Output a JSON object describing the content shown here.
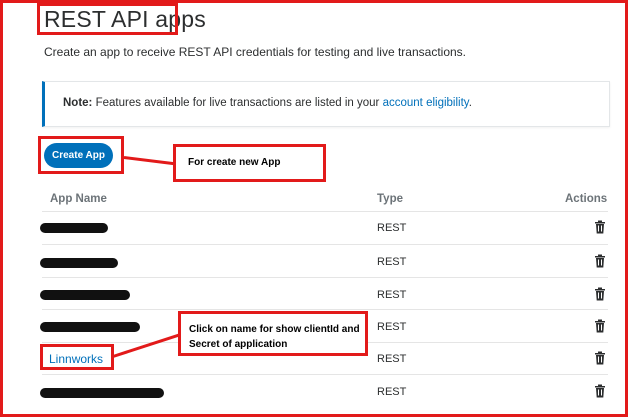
{
  "page": {
    "title": "REST API apps",
    "subtitle": "Create an app to receive REST API credentials for testing and live transactions."
  },
  "note": {
    "label": "Note:",
    "text": " Features available for live transactions are listed in your ",
    "link": "account eligibility",
    "period": "."
  },
  "create_button": "Create App",
  "annotations": {
    "create": "For create new App",
    "click_line1": "Click on name for show clientId and",
    "click_line2": "Secret of application"
  },
  "table": {
    "headers": {
      "name": "App Name",
      "type": "Type",
      "actions": "Actions"
    },
    "rows": [
      {
        "name": "",
        "redacted": true,
        "type": "REST",
        "action_icon": "trash-icon"
      },
      {
        "name": "",
        "redacted": true,
        "type": "REST",
        "action_icon": "trash-icon"
      },
      {
        "name": "",
        "redacted": true,
        "type": "REST",
        "action_icon": "trash-icon"
      },
      {
        "name": "",
        "redacted": true,
        "type": "REST",
        "action_icon": "trash-icon"
      },
      {
        "name": "Linnworks",
        "redacted": false,
        "type": "REST",
        "action_icon": "trash-icon"
      },
      {
        "name": "",
        "redacted": true,
        "type": "REST",
        "action_icon": "trash-icon"
      }
    ]
  },
  "colors": {
    "accent": "#0070ba",
    "annotation": "#e21a1a",
    "text": "#2c2e2f",
    "muted": "#6c7378"
  }
}
